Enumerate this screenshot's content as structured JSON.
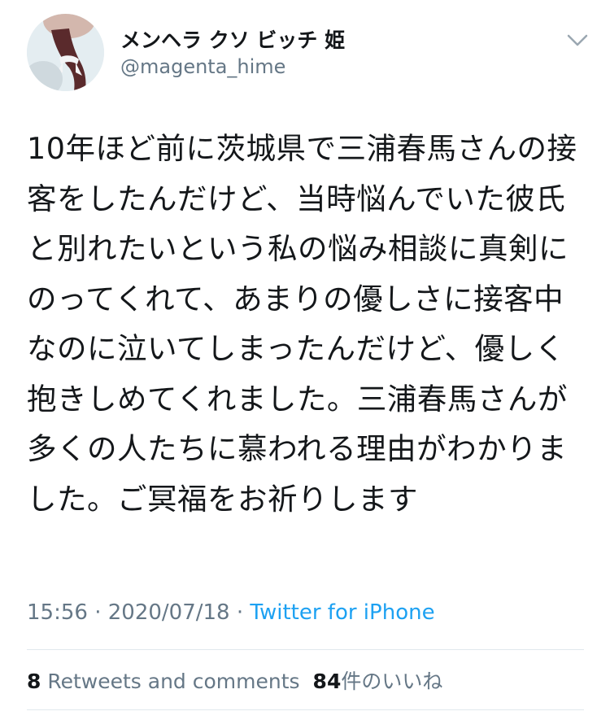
{
  "user": {
    "display_name": "メンヘラ クソ ビッチ 姫",
    "handle": "@magenta_hime"
  },
  "tweet": {
    "text": "10年ほど前に茨城県で三浦春馬さんの接客をしたんだけど、当時悩んでいた彼氏と別れたいという私の悩み相談に真剣にのってくれて、あまりの優しさに接客中なのに泣いてしまったんだけど、優しく抱きしめてくれました。三浦春馬さんが多くの人たちに慕われる理由がわかりました。ご冥福をお祈りします"
  },
  "meta": {
    "time": "15:56",
    "separator": " · ",
    "date": "2020/07/18",
    "source": "Twitter for iPhone"
  },
  "stats": {
    "retweets_count": "8",
    "retweets_label": " Retweets and comments",
    "likes_count": "84",
    "likes_label": "件のいいね"
  },
  "icons": {
    "menu": "chevron-down-icon"
  },
  "colors": {
    "text": "#14171a",
    "secondary": "#657786",
    "link": "#1da1f2",
    "divider": "#e1e8ed"
  }
}
